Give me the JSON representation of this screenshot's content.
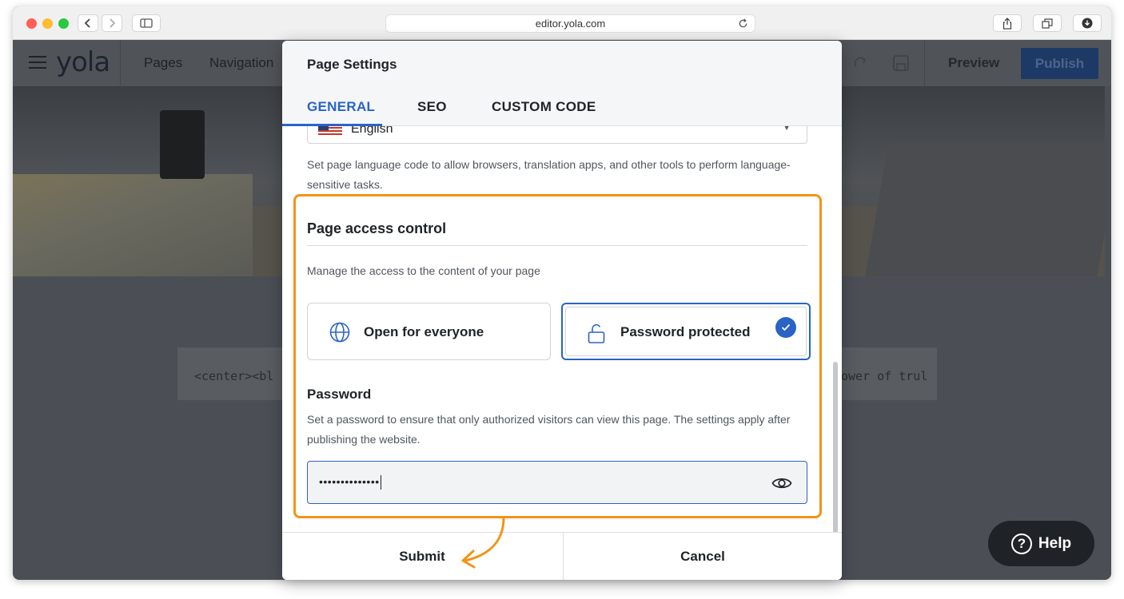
{
  "browser": {
    "url": "editor.yola.com"
  },
  "toolbar": {
    "logo": "yola",
    "pages": "Pages",
    "navigation": "Navigation",
    "preview": "Preview",
    "publish": "Publish"
  },
  "background": {
    "code_left": "<center><bl",
    "code_right": "ower of trul"
  },
  "help": {
    "label": "Help"
  },
  "modal": {
    "title": "Page Settings",
    "tabs": [
      {
        "label": "GENERAL",
        "active": true
      },
      {
        "label": "SEO",
        "active": false
      },
      {
        "label": "CUSTOM CODE",
        "active": false
      }
    ],
    "language": {
      "selected": "English",
      "help": "Set page language code to allow browsers, translation apps, and other tools to perform language-sensitive tasks."
    },
    "access": {
      "title": "Page access control",
      "description": "Manage the access to the content of your page",
      "options": [
        {
          "label": "Open for everyone",
          "icon": "globe-icon",
          "selected": false
        },
        {
          "label": "Password protected",
          "icon": "unlock-icon",
          "selected": true
        }
      ]
    },
    "password": {
      "title": "Password",
      "help": "Set a password to ensure that only authorized visitors can view this page. The settings apply after publishing the website.",
      "value": "••••••••••••••"
    },
    "footer": {
      "submit": "Submit",
      "cancel": "Cancel"
    }
  },
  "colors": {
    "accent": "#2a63c6",
    "annotation": "#f39317",
    "publish_bg": "#1d3a66"
  }
}
